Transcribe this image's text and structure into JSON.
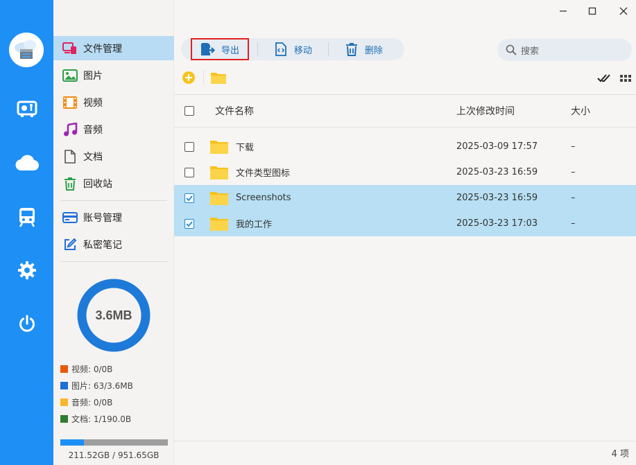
{
  "window": {
    "minimize_label": "–",
    "maximize_label": "□",
    "close_label": "✕"
  },
  "rail": {
    "items": [
      {
        "icon": "video-icon"
      },
      {
        "icon": "cloud-icon"
      },
      {
        "icon": "train-icon"
      },
      {
        "icon": "gear-icon"
      },
      {
        "icon": "power-icon"
      }
    ]
  },
  "sidebar": {
    "items": [
      {
        "label": "文件管理",
        "icon": "devices-icon",
        "active": true
      },
      {
        "label": "图片",
        "icon": "image-icon"
      },
      {
        "label": "视频",
        "icon": "film-icon"
      },
      {
        "label": "音频",
        "icon": "music-icon"
      },
      {
        "label": "文档",
        "icon": "document-icon"
      },
      {
        "label": "回收站",
        "icon": "trash-icon"
      },
      {
        "label": "账号管理",
        "icon": "card-icon"
      },
      {
        "label": "私密笔记",
        "icon": "edit-icon"
      }
    ],
    "storage": {
      "donut_label": "3.6MB",
      "legend": [
        {
          "label": "视频: 0/0B",
          "color": "#e8590c"
        },
        {
          "label": "图片: 63/3.6MB",
          "color": "#1e6fd8"
        },
        {
          "label": "音频: 0/0B",
          "color": "#f5b72b"
        },
        {
          "label": "文档: 1/190.0B",
          "color": "#2e7d32"
        }
      ],
      "usage_fraction": 0.22,
      "usage_text": "211.52GB / 951.65GB"
    }
  },
  "toolbar": {
    "export_label": "导出",
    "move_label": "移动",
    "delete_label": "删除",
    "search_placeholder": "搜索"
  },
  "table": {
    "headers": {
      "name": "文件名称",
      "modified": "上次修改时间",
      "size": "大小"
    },
    "rows": [
      {
        "name": "下载",
        "modified": "2025-03-09 17:57",
        "size": "–",
        "selected": false
      },
      {
        "name": "文件类型图标",
        "modified": "2025-03-23 16:59",
        "size": "–",
        "selected": false
      },
      {
        "name": "Screenshots",
        "modified": "2025-03-23 16:59",
        "size": "–",
        "selected": true
      },
      {
        "name": "我的工作",
        "modified": "2025-03-23 17:03",
        "size": "–",
        "selected": true
      }
    ]
  },
  "status": {
    "count_label": "4 项"
  },
  "colors": {
    "accent": "#1e8ff5",
    "selected_row": "#b8dff3",
    "active_nav": "#b8dcf3",
    "folder": "#f7c21b"
  }
}
